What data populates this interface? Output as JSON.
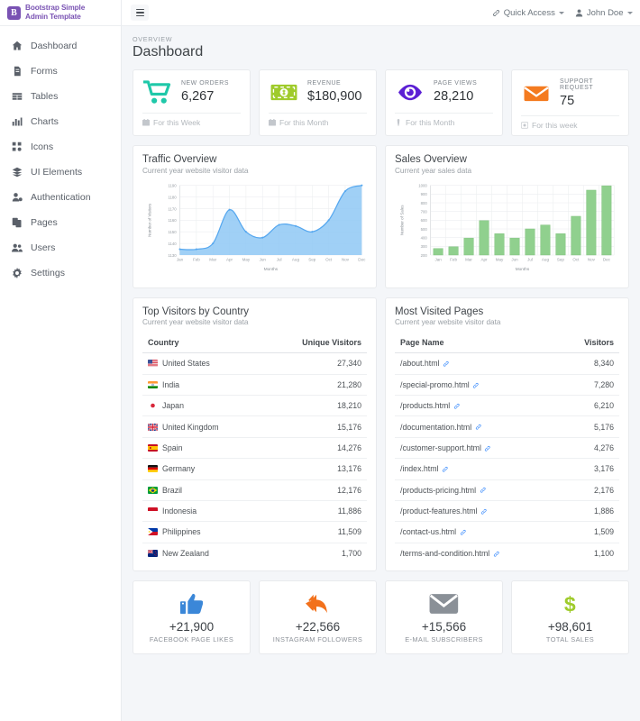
{
  "brand": {
    "mark": "B",
    "line1": "Bootstrap Simple",
    "line2": "Admin Template"
  },
  "sidebar": {
    "items": [
      {
        "label": "Dashboard",
        "icon": "home-icon"
      },
      {
        "label": "Forms",
        "icon": "file-icon"
      },
      {
        "label": "Tables",
        "icon": "table-icon"
      },
      {
        "label": "Charts",
        "icon": "chart-icon"
      },
      {
        "label": "Icons",
        "icon": "icons-icon"
      },
      {
        "label": "UI Elements",
        "icon": "layers-icon"
      },
      {
        "label": "Authentication",
        "icon": "user-lock-icon"
      },
      {
        "label": "Pages",
        "icon": "copy-icon"
      },
      {
        "label": "Users",
        "icon": "users-icon"
      },
      {
        "label": "Settings",
        "icon": "gear-icon"
      }
    ]
  },
  "topbar": {
    "menu_toggle": "hamburger-icon",
    "quick_access": "Quick Access",
    "user": "John Doe"
  },
  "header": {
    "kicker": "OVERVIEW",
    "title": "Dashboard"
  },
  "stats": [
    {
      "label": "NEW ORDERS",
      "value": "6,267",
      "footer": "For this Week",
      "icon": "cart-icon",
      "color": "#1fc8a9"
    },
    {
      "label": "REVENUE",
      "value": "$180,900",
      "footer": "For this Month",
      "icon": "money-icon",
      "color": "#9fcb2b"
    },
    {
      "label": "PAGE VIEWS",
      "value": "28,210",
      "footer": "For this Month",
      "icon": "eye-icon",
      "color": "#5b1fd4"
    },
    {
      "label": "SUPPORT REQUEST",
      "value": "75",
      "footer": "For this week",
      "icon": "envelope-icon",
      "color": "#f47b20"
    }
  ],
  "chart_data": [
    {
      "type": "area",
      "title": "Traffic Overview",
      "subtitle": "Current year website visitor data",
      "xlabel": "Months",
      "ylabel": "Number of Visitors",
      "categories": [
        "Jan",
        "Feb",
        "Mar",
        "Apr",
        "May",
        "Jun",
        "Jul",
        "Aug",
        "Sep",
        "Oct",
        "Nov",
        "Dec"
      ],
      "values": [
        1135,
        1135,
        1140,
        1169,
        1150,
        1145,
        1156,
        1155,
        1150,
        1160,
        1185,
        1190
      ],
      "ylim": [
        1130,
        1190
      ],
      "yticks": [
        1130,
        1140,
        1150,
        1160,
        1170,
        1180,
        1190
      ],
      "grid": true,
      "legend": "none",
      "color": "#55a7ef",
      "fill": "#8fc8f5"
    },
    {
      "type": "bar",
      "title": "Sales Overview",
      "subtitle": "Current year sales data",
      "xlabel": "Months",
      "ylabel": "Number of Sales",
      "categories": [
        "Jan",
        "Feb",
        "Mar",
        "Apr",
        "May",
        "Jun",
        "Jul",
        "Aug",
        "Sep",
        "Oct",
        "Nov",
        "Dec"
      ],
      "values": [
        275,
        295,
        395,
        595,
        445,
        395,
        500,
        545,
        445,
        645,
        945,
        995
      ],
      "ylim": [
        200,
        1000
      ],
      "yticks": [
        200,
        300,
        400,
        500,
        600,
        700,
        800,
        900,
        1000
      ],
      "grid": true,
      "legend": "none",
      "color": "#90d08e"
    }
  ],
  "countries_card": {
    "title": "Top Visitors by Country",
    "subtitle": "Current year website visitor data",
    "col_country": "Country",
    "col_visitors": "Unique Visitors",
    "rows": [
      {
        "country": "United States",
        "visitors": "27,340",
        "flag": "flag-us"
      },
      {
        "country": "India",
        "visitors": "21,280",
        "flag": "flag-in"
      },
      {
        "country": "Japan",
        "visitors": "18,210",
        "flag": "flag-jp"
      },
      {
        "country": "United Kingdom",
        "visitors": "15,176",
        "flag": "flag-gb"
      },
      {
        "country": "Spain",
        "visitors": "14,276",
        "flag": "flag-es"
      },
      {
        "country": "Germany",
        "visitors": "13,176",
        "flag": "flag-de"
      },
      {
        "country": "Brazil",
        "visitors": "12,176",
        "flag": "flag-br"
      },
      {
        "country": "Indonesia",
        "visitors": "11,886",
        "flag": "flag-id"
      },
      {
        "country": "Philippines",
        "visitors": "11,509",
        "flag": "flag-ph"
      },
      {
        "country": "New Zealand",
        "visitors": "1,700",
        "flag": "flag-nz"
      }
    ]
  },
  "pages_card": {
    "title": "Most Visited Pages",
    "subtitle": "Current year website visitor data",
    "col_page": "Page Name",
    "col_visitors": "Visitors",
    "rows": [
      {
        "page": "/about.html",
        "visitors": "8,340"
      },
      {
        "page": "/special-promo.html",
        "visitors": "7,280"
      },
      {
        "page": "/products.html",
        "visitors": "6,210"
      },
      {
        "page": "/documentation.html",
        "visitors": "5,176"
      },
      {
        "page": "/customer-support.html",
        "visitors": "4,276"
      },
      {
        "page": "/index.html",
        "visitors": "3,176"
      },
      {
        "page": "/products-pricing.html",
        "visitors": "2,176"
      },
      {
        "page": "/product-features.html",
        "visitors": "1,886"
      },
      {
        "page": "/contact-us.html",
        "visitors": "1,509"
      },
      {
        "page": "/terms-and-condition.html",
        "visitors": "1,100"
      }
    ]
  },
  "socials": [
    {
      "value": "+21,900",
      "label": "FACEBOOK PAGE LIKES",
      "icon": "thumbs-up-icon",
      "color": "#3b87d8"
    },
    {
      "value": "+22,566",
      "label": "INSTAGRAM FOLLOWERS",
      "icon": "share-reply-icon",
      "color": "#f2711c"
    },
    {
      "value": "+15,566",
      "label": "E-MAIL SUBSCRIBERS",
      "icon": "envelope-gray-icon",
      "color": "#8a9097"
    },
    {
      "value": "+98,601",
      "label": "TOTAL SALES",
      "icon": "dollar-icon",
      "color": "#9fcb2b"
    }
  ]
}
